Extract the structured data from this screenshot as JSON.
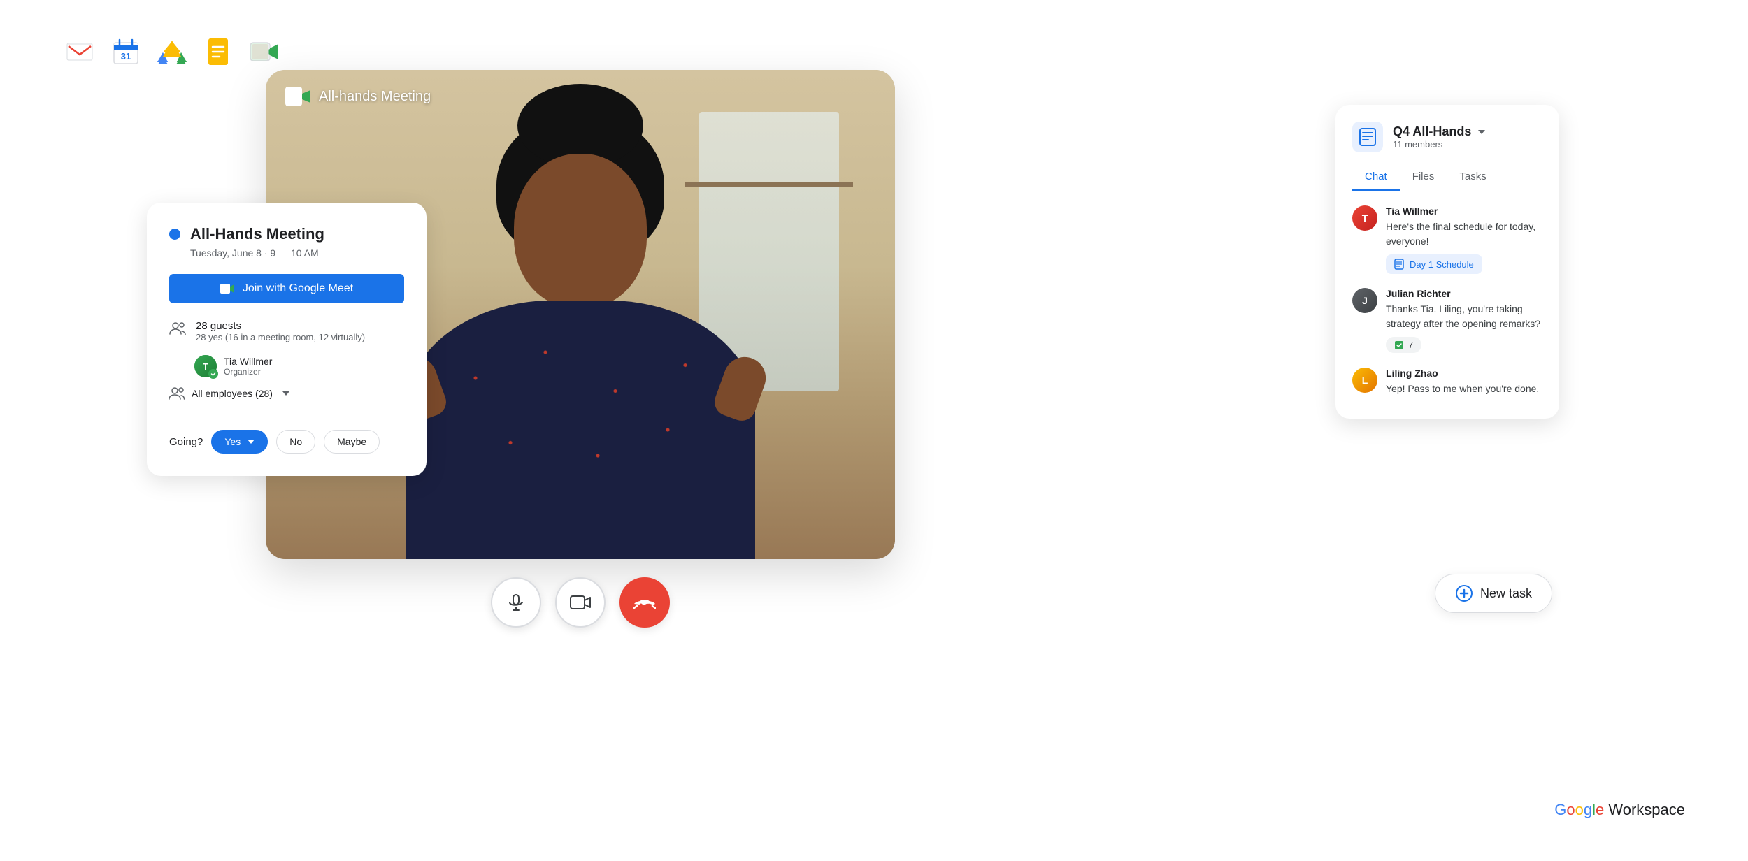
{
  "appBar": {
    "apps": [
      {
        "name": "Gmail",
        "label": "M",
        "color": "#ea4335"
      },
      {
        "name": "Calendar",
        "label": "31",
        "color": "#1a73e8"
      },
      {
        "name": "Drive",
        "label": "▲",
        "color": "#fbbc04"
      },
      {
        "name": "Docs",
        "label": "📄",
        "color": "#4285f4"
      },
      {
        "name": "Meet",
        "label": "▶",
        "color": "#34a853"
      }
    ]
  },
  "videoCall": {
    "title": "All-hands Meeting",
    "meetIcon": "meet-icon"
  },
  "calendarCard": {
    "eventTitle": "All-Hands Meeting",
    "eventDate": "Tuesday, June 8 · 9 — 10 AM",
    "joinButtonLabel": "Join with Google Meet",
    "guestsCount": "28 guests",
    "guestsDetail": "28 yes (16 in a meeting room, 12 virtually)",
    "organizerName": "Tia Willmer",
    "organizerRole": "Organizer",
    "allEmployeesLabel": "All employees (28)",
    "goingLabel": "Going?",
    "yesLabel": "Yes",
    "noLabel": "No",
    "maybeLabel": "Maybe"
  },
  "chatPanel": {
    "title": "Q4 All-Hands",
    "membersCount": "11 members",
    "tabs": [
      {
        "label": "Chat",
        "active": true
      },
      {
        "label": "Files",
        "active": false
      },
      {
        "label": "Tasks",
        "active": false
      }
    ],
    "messages": [
      {
        "sender": "Tia Willmer",
        "text": "Here's the final schedule for today, everyone!",
        "attachment": "Day 1 Schedule",
        "avatarInitial": "T"
      },
      {
        "sender": "Julian Richter",
        "text": "Thanks Tia. Liling, you're taking strategy after the opening remarks?",
        "reaction": "7",
        "avatarInitial": "J"
      },
      {
        "sender": "Liling Zhao",
        "text": "Yep! Pass to me when you're done.",
        "avatarInitial": "L"
      }
    ]
  },
  "newTask": {
    "label": "New task"
  },
  "controls": {
    "mic": "microphone",
    "video": "video-camera",
    "endCall": "end-call"
  },
  "brand": {
    "google": "Google",
    "workspace": " Workspace"
  }
}
